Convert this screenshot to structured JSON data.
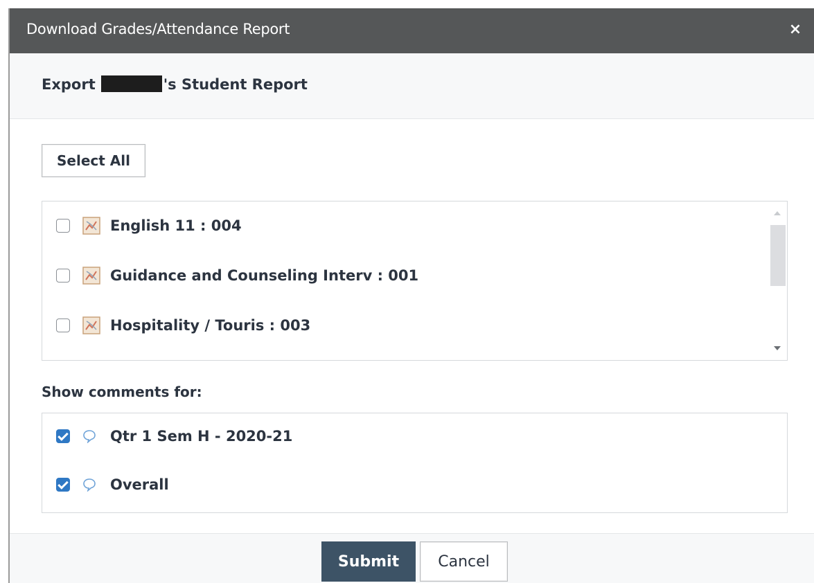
{
  "dialog": {
    "title": "Download Grades/Attendance Report",
    "close_glyph": "×"
  },
  "header": {
    "export_prefix": "Export",
    "export_suffix": "'s Student Report"
  },
  "select_all_label": "Select All",
  "courses": [
    {
      "label": "English 11 : 004",
      "checked": false,
      "icon": "course-icon"
    },
    {
      "label": "Guidance and Counseling Interv : 001",
      "checked": false,
      "icon": "course-icon"
    },
    {
      "label": "Hospitality / Touris : 003",
      "checked": false,
      "icon": "course-icon"
    }
  ],
  "comments": {
    "heading": "Show comments for:",
    "items": [
      {
        "label": "Qtr 1 Sem H - 2020-21",
        "checked": true,
        "icon": "comment-icon"
      },
      {
        "label": "Overall",
        "checked": true,
        "icon": "comment-icon"
      }
    ]
  },
  "footer": {
    "submit_label": "Submit",
    "cancel_label": "Cancel"
  },
  "colors": {
    "titlebar": "#555758",
    "primary_button": "#3d5366",
    "checkbox_checked": "#2f78c4",
    "text": "#2c3440"
  }
}
